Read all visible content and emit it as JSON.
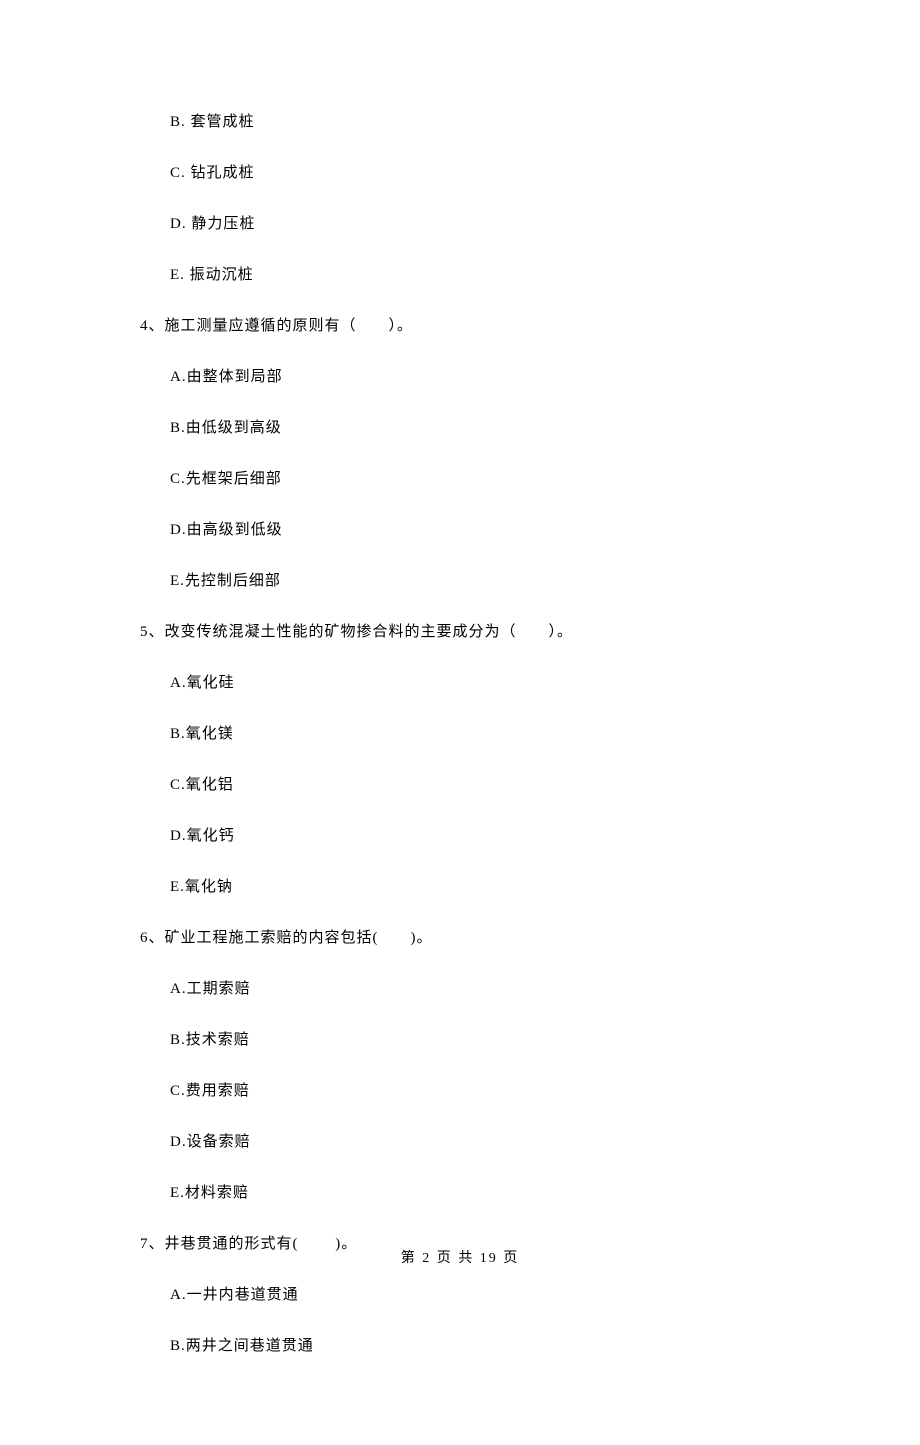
{
  "opt_B_prev": "B.  套管成桩",
  "opt_C_prev": "C.  钻孔成桩",
  "opt_D_prev": "D.  静力压桩",
  "opt_E_prev": "E.  振动沉桩",
  "q4": "4、施工测量应遵循的原则有（　　）。",
  "q4_A": "A.由整体到局部",
  "q4_B": "B.由低级到高级",
  "q4_C": "C.先框架后细部",
  "q4_D": "D.由高级到低级",
  "q4_E": "E.先控制后细部",
  "q5": "5、改变传统混凝土性能的矿物掺合料的主要成分为（　　）。",
  "q5_A": "A.氧化硅",
  "q5_B": "B.氧化镁",
  "q5_C": "C.氧化铝",
  "q5_D": "D.氧化钙",
  "q5_E": "E.氧化钠",
  "q6": "6、矿业工程施工索赔的内容包括(　　)。",
  "q6_A": "A.工期索赔",
  "q6_B": "B.技术索赔",
  "q6_C": "C.费用索赔",
  "q6_D": "D.设备索赔",
  "q6_E": "E.材料索赔",
  "q7": "7、井巷贯通的形式有(　　 )。",
  "q7_A": "A.一井内巷道贯通",
  "q7_B": "B.两井之间巷道贯通",
  "footer": "第 2 页 共 19 页"
}
